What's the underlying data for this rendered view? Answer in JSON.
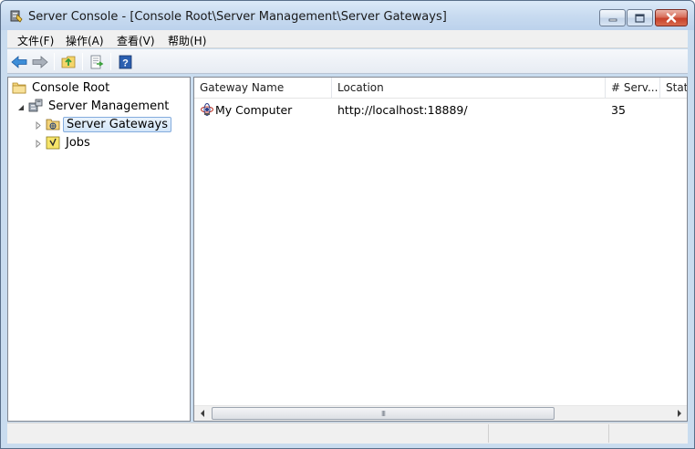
{
  "window": {
    "title": "Server Console - [Console Root\\Server Management\\Server Gateways]"
  },
  "menu": [
    {
      "label": "文件(F)"
    },
    {
      "label": "操作(A)"
    },
    {
      "label": "查看(V)"
    },
    {
      "label": "帮助(H)"
    }
  ],
  "toolbar": {
    "icons": [
      "back-arrow-icon",
      "forward-arrow-icon",
      "up-folder-icon",
      "export-list-icon",
      "help-icon"
    ]
  },
  "tree": {
    "root": {
      "label": "Console Root",
      "icon": "folder-icon"
    },
    "server_management": {
      "label": "Server Management",
      "icon": "server-management-icon"
    },
    "server_gateways": {
      "label": "Server Gateways",
      "icon": "gateway-folder-icon",
      "selected": true
    },
    "jobs": {
      "label": "Jobs",
      "icon": "jobs-folder-icon"
    }
  },
  "list": {
    "columns": [
      {
        "label": "Gateway Name"
      },
      {
        "label": "Location"
      },
      {
        "label": "# Serv..."
      },
      {
        "label": "Stat"
      }
    ],
    "rows": [
      {
        "name": "My Computer",
        "location": "http://localhost:18889/",
        "servers": "35",
        "status": ""
      }
    ],
    "scroll_thumb_glyph": "III"
  },
  "colors": {
    "accent": "#84acdd",
    "close_button": "#c8412a",
    "selection": "#d3e6f9"
  }
}
